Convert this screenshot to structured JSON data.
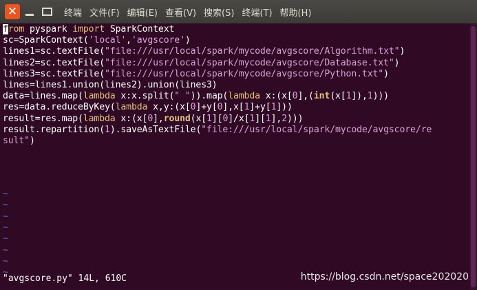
{
  "window": {
    "menu": [
      "终端",
      "文件(F)",
      "编辑(E)",
      "查看(V)",
      "搜索(S)",
      "终端(T)",
      "帮助(H)"
    ]
  },
  "editor": {
    "lines": [
      [
        {
          "t": "f",
          "c": "cursor"
        },
        {
          "t": "rom ",
          "c": "kw"
        },
        {
          "t": "pyspark ",
          "c": ""
        },
        {
          "t": "import ",
          "c": "kw"
        },
        {
          "t": "SparkContext",
          "c": ""
        }
      ],
      [
        {
          "t": "sc=SparkContext(",
          "c": ""
        },
        {
          "t": "'local'",
          "c": "str"
        },
        {
          "t": ",",
          "c": ""
        },
        {
          "t": "'avgscore'",
          "c": "str"
        },
        {
          "t": ")",
          "c": ""
        }
      ],
      [
        {
          "t": "lines1=sc.textFile(",
          "c": ""
        },
        {
          "t": "\"file:///usr/local/spark/mycode/avgscore/Algorithm.txt\"",
          "c": "str"
        },
        {
          "t": ")",
          "c": ""
        }
      ],
      [
        {
          "t": "lines2=sc.textFile(",
          "c": ""
        },
        {
          "t": "\"file:///usr/local/spark/mycode/avgscore/Database.txt\"",
          "c": "str"
        },
        {
          "t": ")",
          "c": ""
        }
      ],
      [
        {
          "t": "lines3=sc.textFile(",
          "c": ""
        },
        {
          "t": "\"file:///usr/local/spark/mycode/avgscore/Python.txt\"",
          "c": "str"
        },
        {
          "t": ")",
          "c": ""
        }
      ],
      [
        {
          "t": "lines=lines1.union(lines2).union(lines3)",
          "c": ""
        }
      ],
      [
        {
          "t": "data=lines.map(",
          "c": ""
        },
        {
          "t": "lambda ",
          "c": "kw"
        },
        {
          "t": "x:x.split(",
          "c": ""
        },
        {
          "t": "\" \"",
          "c": "str"
        },
        {
          "t": ")).map(",
          "c": ""
        },
        {
          "t": "lambda ",
          "c": "kw"
        },
        {
          "t": "x:(x[",
          "c": ""
        },
        {
          "t": "0",
          "c": "num"
        },
        {
          "t": "],(",
          "c": ""
        },
        {
          "t": "int",
          "c": "fn"
        },
        {
          "t": "(x[",
          "c": ""
        },
        {
          "t": "1",
          "c": "num"
        },
        {
          "t": "]),",
          "c": ""
        },
        {
          "t": "1",
          "c": "num"
        },
        {
          "t": ")))",
          "c": ""
        }
      ],
      [
        {
          "t": "res=data.reduceByKey(",
          "c": ""
        },
        {
          "t": "lambda ",
          "c": "kw"
        },
        {
          "t": "x,y:(x[",
          "c": ""
        },
        {
          "t": "0",
          "c": "num"
        },
        {
          "t": "]+y[",
          "c": ""
        },
        {
          "t": "0",
          "c": "num"
        },
        {
          "t": "],x[",
          "c": ""
        },
        {
          "t": "1",
          "c": "num"
        },
        {
          "t": "]+y[",
          "c": ""
        },
        {
          "t": "1",
          "c": "num"
        },
        {
          "t": "]))",
          "c": ""
        }
      ],
      [
        {
          "t": "result=res.map(",
          "c": ""
        },
        {
          "t": "lambda ",
          "c": "kw"
        },
        {
          "t": "x:(x[",
          "c": ""
        },
        {
          "t": "0",
          "c": "num"
        },
        {
          "t": "],",
          "c": ""
        },
        {
          "t": "round",
          "c": "fn"
        },
        {
          "t": "(x[",
          "c": ""
        },
        {
          "t": "1",
          "c": "num"
        },
        {
          "t": "][",
          "c": ""
        },
        {
          "t": "0",
          "c": "num"
        },
        {
          "t": "]/x[",
          "c": ""
        },
        {
          "t": "1",
          "c": "num"
        },
        {
          "t": "][",
          "c": ""
        },
        {
          "t": "1",
          "c": "num"
        },
        {
          "t": "],",
          "c": ""
        },
        {
          "t": "2",
          "c": "num"
        },
        {
          "t": ")))",
          "c": ""
        }
      ],
      [
        {
          "t": "result.repartition(",
          "c": ""
        },
        {
          "t": "1",
          "c": "num"
        },
        {
          "t": ").saveAsTextFile(",
          "c": ""
        },
        {
          "t": "\"file:///usr/local/spark/mycode/avgscore/re",
          "c": "str"
        }
      ],
      [
        {
          "t": "sult\"",
          "c": "str"
        },
        {
          "t": ")",
          "c": ""
        }
      ]
    ],
    "tilde": "~",
    "tilde_count": 8,
    "status": "\"avgscore.py\" 14L, 610C"
  },
  "colors": {
    "background": "#300a24",
    "keyword": "#e0c07a",
    "string": "#d9a0d8",
    "tilde": "#5a6fcf",
    "close_button": "#e95420"
  },
  "watermark": "https://blog.csdn.net/space202020"
}
